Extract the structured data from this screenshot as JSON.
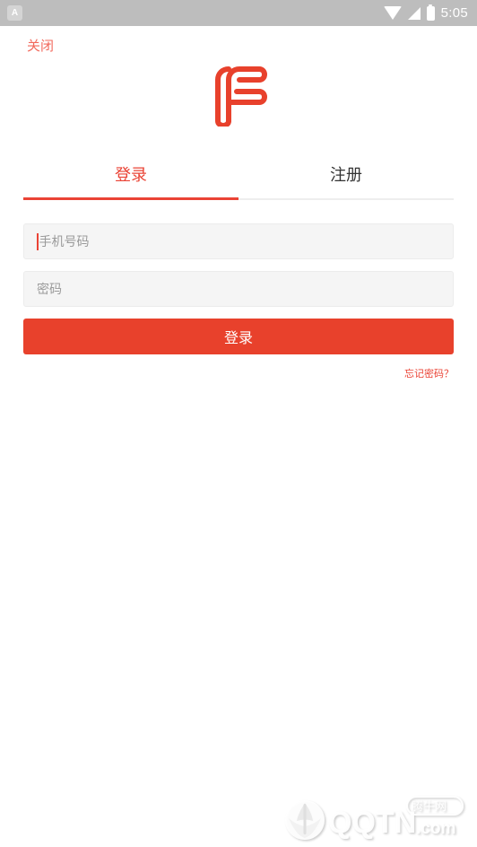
{
  "status_bar": {
    "app_badge_glyph": "A",
    "app_badge_icon": "app-notification-icon",
    "wifi_icon": "wifi-icon",
    "signal_icon": "cellular-signal-icon",
    "battery_icon": "battery-icon",
    "time": "5:05",
    "background_color": "#bdbdbd"
  },
  "header": {
    "close_label": "关闭",
    "close_color": "#f2695c",
    "logo_icon": "brand-f-logo-icon",
    "logo_color": "#e8412c"
  },
  "tabs": {
    "items": [
      {
        "label": "登录",
        "active": true
      },
      {
        "label": "注册",
        "active": false
      }
    ],
    "active_color": "#ea4335",
    "inactive_color": "#333333",
    "indicator_color": "#ea4335",
    "track_color": "#eeeeee"
  },
  "form": {
    "phone": {
      "placeholder": "手机号码",
      "value": "",
      "focused": true,
      "caret_color": "#ea4335"
    },
    "password": {
      "placeholder": "密码",
      "value": "",
      "focused": false
    },
    "submit_label": "登录",
    "submit_color": "#e8412c",
    "forgot_label": "忘记密码？",
    "forgot_color": "#ea4335",
    "field_background": "#f5f5f5",
    "placeholder_color": "#9a9a9a"
  },
  "watermark": {
    "site_name": "QQTN",
    "domain_suffix": ".com",
    "badge_label": "腾牛网",
    "logo_icon": "qqtn-globe-logo-icon"
  }
}
